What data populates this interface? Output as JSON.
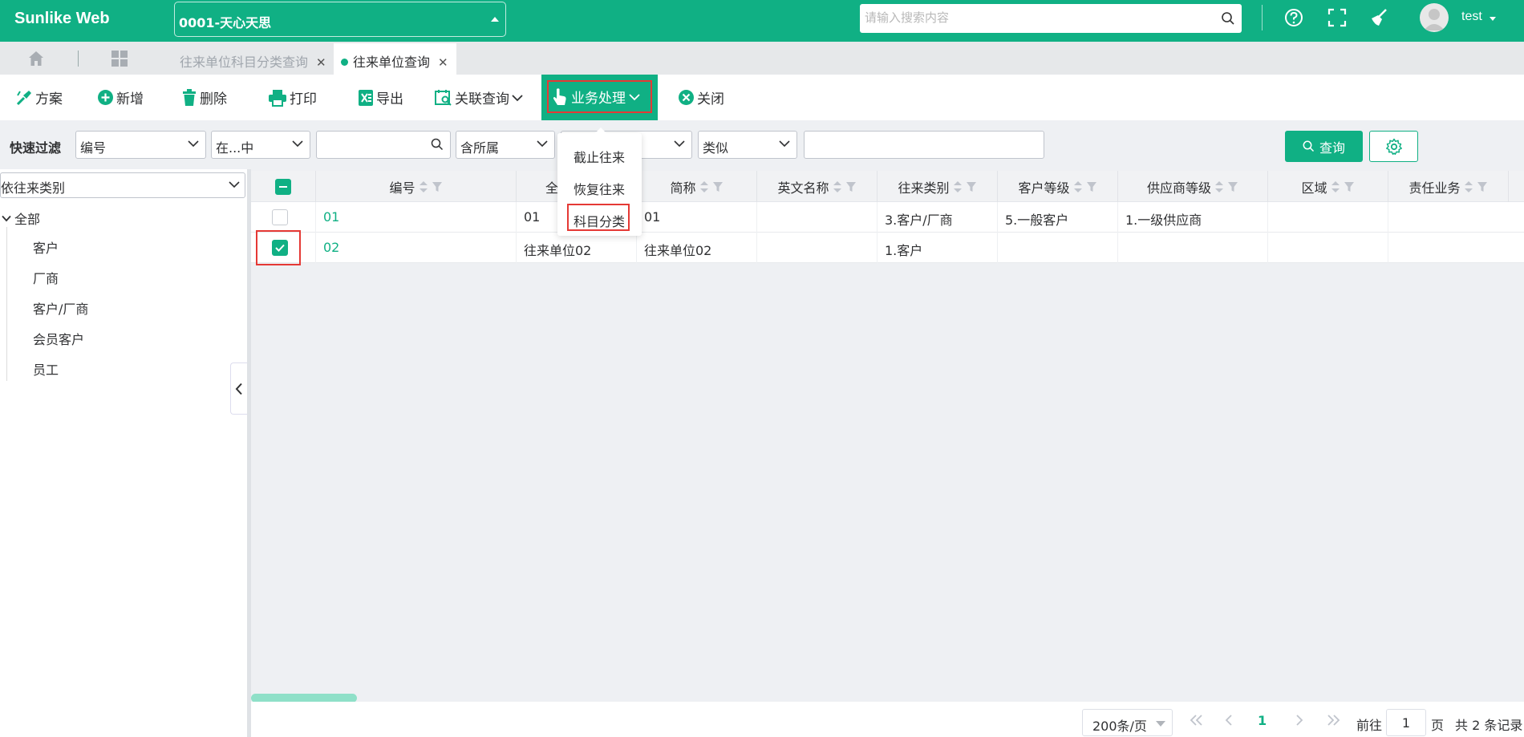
{
  "app": {
    "brand": "Sunlike Web",
    "company": "0001-天心天思",
    "username": "test"
  },
  "search": {
    "placeholder": "请输入搜索内容"
  },
  "tabs": [
    {
      "label": "往来单位科目分类查询",
      "active": false
    },
    {
      "label": "往来单位查询",
      "active": true
    }
  ],
  "toolbar": {
    "scheme": "方案",
    "add": "新增",
    "delete": "删除",
    "print": "打印",
    "export": "导出",
    "related_query": "关联查询",
    "business": "业务处理",
    "close": "关闭"
  },
  "dropdown": {
    "items": [
      "截止往来",
      "恢复往来",
      "科目分类"
    ],
    "highlighted": "科目分类"
  },
  "filter": {
    "label": "快速过滤",
    "field": "编号",
    "operator": "在...中",
    "value": "",
    "scope": "含所属",
    "match_type": "类似",
    "text": "",
    "query_button": "查询"
  },
  "left_panel": {
    "group_by": "依往来类别",
    "root": "全部",
    "items": [
      "客户",
      "厂商",
      "客户/厂商",
      "会员客户",
      "员工"
    ]
  },
  "grid": {
    "columns": [
      "编号",
      "全",
      "简称",
      "英文名称",
      "往来类别",
      "客户等级",
      "供应商等级",
      "区域",
      "责任业务"
    ],
    "rows": [
      {
        "checked": false,
        "cells": [
          "01",
          "01",
          "01",
          "",
          "3.客户/厂商",
          "5.一般客户",
          "1.一级供应商",
          "",
          ""
        ]
      },
      {
        "checked": true,
        "cells": [
          "02",
          "往来单位02",
          "往来单位02",
          "",
          "1.客户",
          "",
          "",
          "",
          ""
        ]
      }
    ]
  },
  "pagination": {
    "page_size": "200条/页",
    "current_page": "1",
    "goto_prefix": "前往",
    "goto_value": "1",
    "goto_suffix": "页",
    "total": "共 2 条记录"
  },
  "colors": {
    "primary": "#10b084",
    "highlight": "#e53935"
  }
}
